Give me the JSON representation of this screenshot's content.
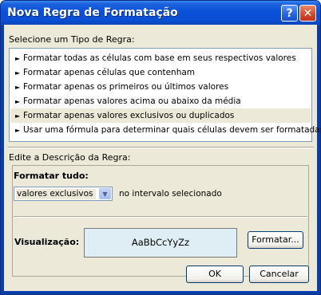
{
  "window": {
    "title": "Nova Regra de Formatação",
    "help_glyph": "?",
    "close_glyph": "✕"
  },
  "rule_type": {
    "label": "Selecione um Tipo de Regra:",
    "items": [
      {
        "label": "Formatar todas as células com base em seus respectivos valores"
      },
      {
        "label": "Formatar apenas células que contenham"
      },
      {
        "label": "Formatar apenas os primeiros ou últimos valores"
      },
      {
        "label": "Formatar apenas valores acima ou abaixo da média"
      },
      {
        "label": "Formatar apenas valores exclusivos ou duplicados",
        "selected": true
      },
      {
        "label": "Usar uma fórmula para determinar quais células devem ser formatadas"
      }
    ],
    "arrow_glyph": "►"
  },
  "description": {
    "label": "Edite a Descrição da Regra:",
    "format_all_label": "Formatar tudo:",
    "select_value": "valores exclusivos",
    "range_text": "no intervalo selecionado",
    "preview_label": "Visualização:",
    "preview_text": "AaBbCcYyZz",
    "format_button": "Formatar..."
  },
  "footer": {
    "ok_button": "OK",
    "cancel_button": "Cancelar"
  },
  "colors": {
    "title_bar": "#0a50d8",
    "dialog_bg": "#ece9d8",
    "preview_bg": "#dfeef5"
  }
}
